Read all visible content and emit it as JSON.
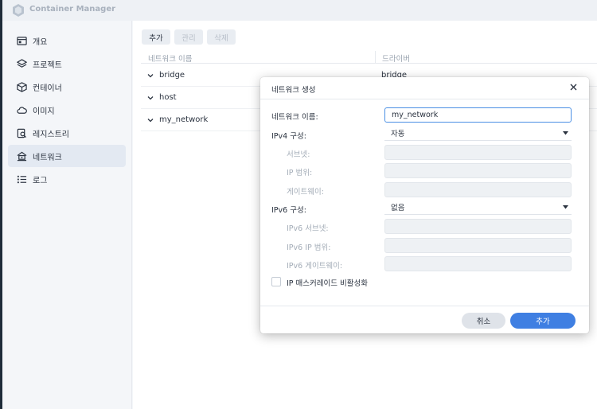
{
  "app": {
    "title": "Container Manager"
  },
  "sidebar": {
    "items": [
      {
        "label": "개요",
        "icon": "overview-icon",
        "active": false
      },
      {
        "label": "프로젝트",
        "icon": "project-icon",
        "active": false
      },
      {
        "label": "컨테이너",
        "icon": "container-icon",
        "active": false
      },
      {
        "label": "이미지",
        "icon": "image-cloud-icon",
        "active": false
      },
      {
        "label": "레지스트리",
        "icon": "registry-icon",
        "active": false
      },
      {
        "label": "네트워크",
        "icon": "network-icon",
        "active": true
      },
      {
        "label": "로그",
        "icon": "log-list-icon",
        "active": false
      }
    ]
  },
  "toolbar": {
    "add_label": "추가",
    "manage_label": "관리",
    "delete_label": "삭제"
  },
  "table": {
    "columns": [
      "네트워크 이름",
      "드라이버"
    ],
    "rows": [
      {
        "name": "bridge",
        "driver": "bridge"
      },
      {
        "name": "host",
        "driver": ""
      },
      {
        "name": "my_network",
        "driver": ""
      }
    ]
  },
  "dialog": {
    "title": "네트워크 생성",
    "fields": {
      "network_name": {
        "label": "네트워크 이름:",
        "value": "my_network"
      },
      "ipv4_config": {
        "label": "IPv4 구성:",
        "value": "자동"
      },
      "subnet": {
        "label": "서브넷:",
        "value": ""
      },
      "ip_range": {
        "label": "IP 범위:",
        "value": ""
      },
      "gateway": {
        "label": "게이트웨이:",
        "value": ""
      },
      "ipv6_config": {
        "label": "IPv6 구성:",
        "value": "없음"
      },
      "ipv6_subnet": {
        "label": "IPv6 서브넷:",
        "value": ""
      },
      "ipv6_ip_range": {
        "label": "IPv6 IP 범위:",
        "value": ""
      },
      "ipv6_gateway": {
        "label": "IPv6 게이트웨이:",
        "value": ""
      }
    },
    "checkbox_label": "IP 매스커레이드 비활성화",
    "checkbox_checked": false,
    "cancel_label": "취소",
    "submit_label": "추가"
  },
  "colors": {
    "accent": "#3f7fe2",
    "sidebar_active": "#e3e9f2",
    "focus_border": "#4a8fe4"
  }
}
